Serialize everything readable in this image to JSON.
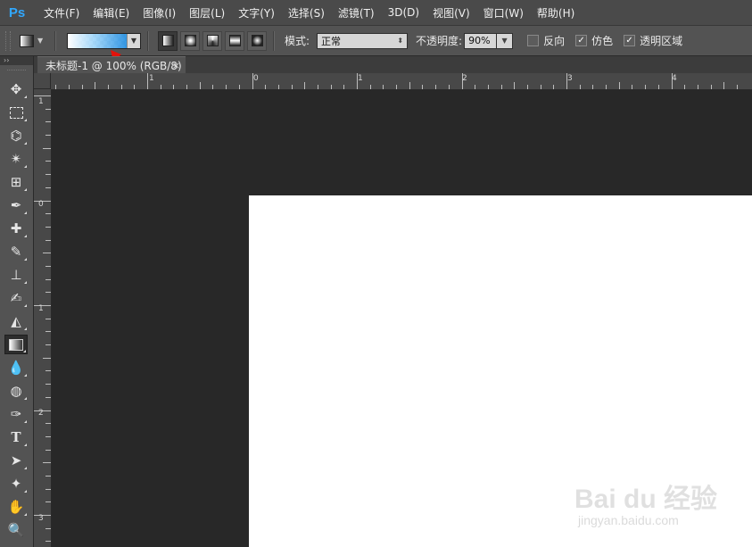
{
  "app": {
    "logo": "Ps"
  },
  "menu": [
    "文件(F)",
    "编辑(E)",
    "图像(I)",
    "图层(L)",
    "文字(Y)",
    "选择(S)",
    "滤镜(T)",
    "3D(D)",
    "视图(V)",
    "窗口(W)",
    "帮助(H)"
  ],
  "options": {
    "mode_label": "模式:",
    "mode_value": "正常",
    "opacity_label": "不透明度:",
    "opacity_value": "90%",
    "reverse_label": "反向",
    "dither_label": "仿色",
    "transparency_label": "透明区域",
    "reverse_checked": false,
    "dither_checked": true,
    "transparency_checked": true
  },
  "document_tab": {
    "title": "未标题-1 @ 100% (RGB/8)",
    "close": "×"
  },
  "rulers": {
    "top_labels": [
      "1",
      "0",
      "1",
      "2",
      "3",
      "4"
    ],
    "left_labels": [
      "1",
      "0",
      "1",
      "2",
      "3"
    ]
  },
  "toolbar": {
    "collapse": "››"
  },
  "watermark": {
    "brand": "Bai du 经验",
    "url": "jingyan.baidu.com"
  },
  "colors": {
    "menubar": "#4a4a4a",
    "panel": "#535353",
    "workspace": "#282828",
    "canvas": "#ffffff",
    "accent_arrow": "#e3120b",
    "logo": "#31a8ff"
  }
}
